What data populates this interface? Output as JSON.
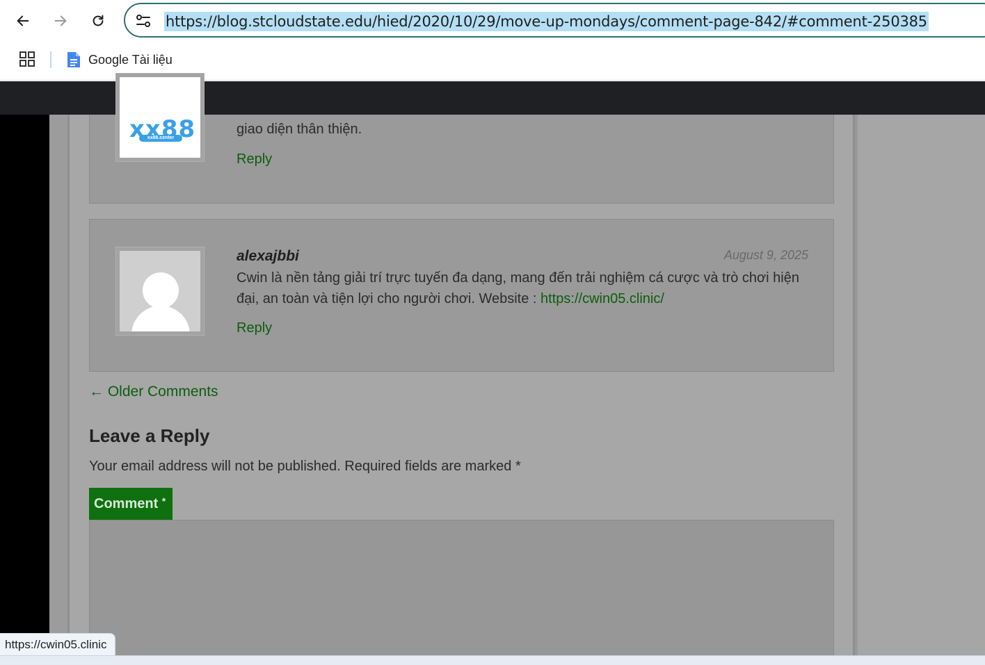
{
  "browser": {
    "url": "https://blog.stcloudstate.edu/hied/2020/10/29/move-up-mondays/comment-page-842/#comment-250385",
    "bookmarks": [
      {
        "label": "Google Tài liệu",
        "icon": "google-docs-icon"
      }
    ],
    "status_url": "https://cwin05.clinic"
  },
  "comments": [
    {
      "avatar_text": "xx88",
      "avatar_subtext": "xx88.center",
      "text_partial": "giao diện thân thiện.",
      "reply_label": "Reply"
    },
    {
      "author": "alexajbbi",
      "date": "August 9, 2025",
      "text": "Cwin là nền tảng giải trí trực tuyến đa dạng, mang đến trải nghiệm cá cược và trò chơi hiện đại, an toàn và tiện lợi cho người chơi. Website :",
      "link_text": "https://cwin05.clinic/",
      "reply_label": "Reply"
    }
  ],
  "older_comments_label": "← Older Comments",
  "leave_reply": {
    "title": "Leave a Reply",
    "notes": "Your email address will not be published. Required fields are marked",
    "required_mark": "*",
    "comment_label": "Comment",
    "comment_required": "*"
  },
  "colors": {
    "link_green": "#0c5d0c",
    "header_dark": "#1e2023",
    "url_highlight": "#b4dff5"
  }
}
